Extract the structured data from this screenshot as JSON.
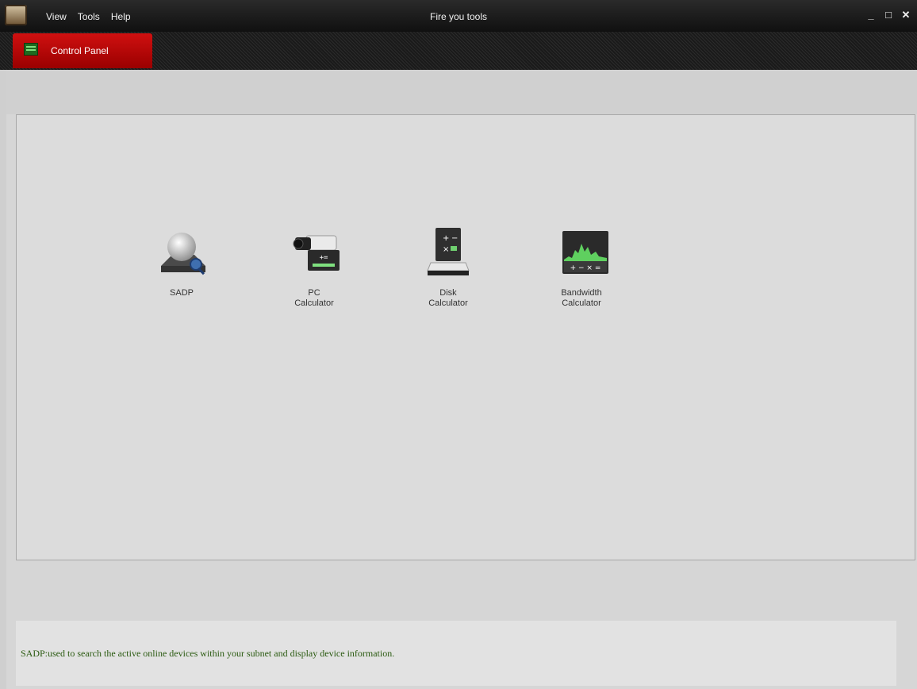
{
  "titlebar": {
    "title": "Fire you tools",
    "menu": [
      "View",
      "Tools",
      "Help"
    ],
    "controls": {
      "minimize": "_",
      "maximize": "□",
      "close": "✕"
    }
  },
  "tabs": [
    {
      "label": "Control Panel",
      "active": true
    }
  ],
  "tools": [
    {
      "label": "SADP",
      "icon": "sadp-icon"
    },
    {
      "label": "PC\nCalculator",
      "icon": "pc-calculator-icon"
    },
    {
      "label": "Disk\nCalculator",
      "icon": "disk-calculator-icon"
    },
    {
      "label": "Bandwidth\nCalculator",
      "icon": "bandwidth-calculator-icon"
    }
  ],
  "status": {
    "text": "SADP:used to search the active online devices within your subnet and display device information."
  },
  "colors": {
    "accent": "#c00000",
    "status_text": "#2a5a10",
    "titlebar": "#1a1a1a"
  }
}
